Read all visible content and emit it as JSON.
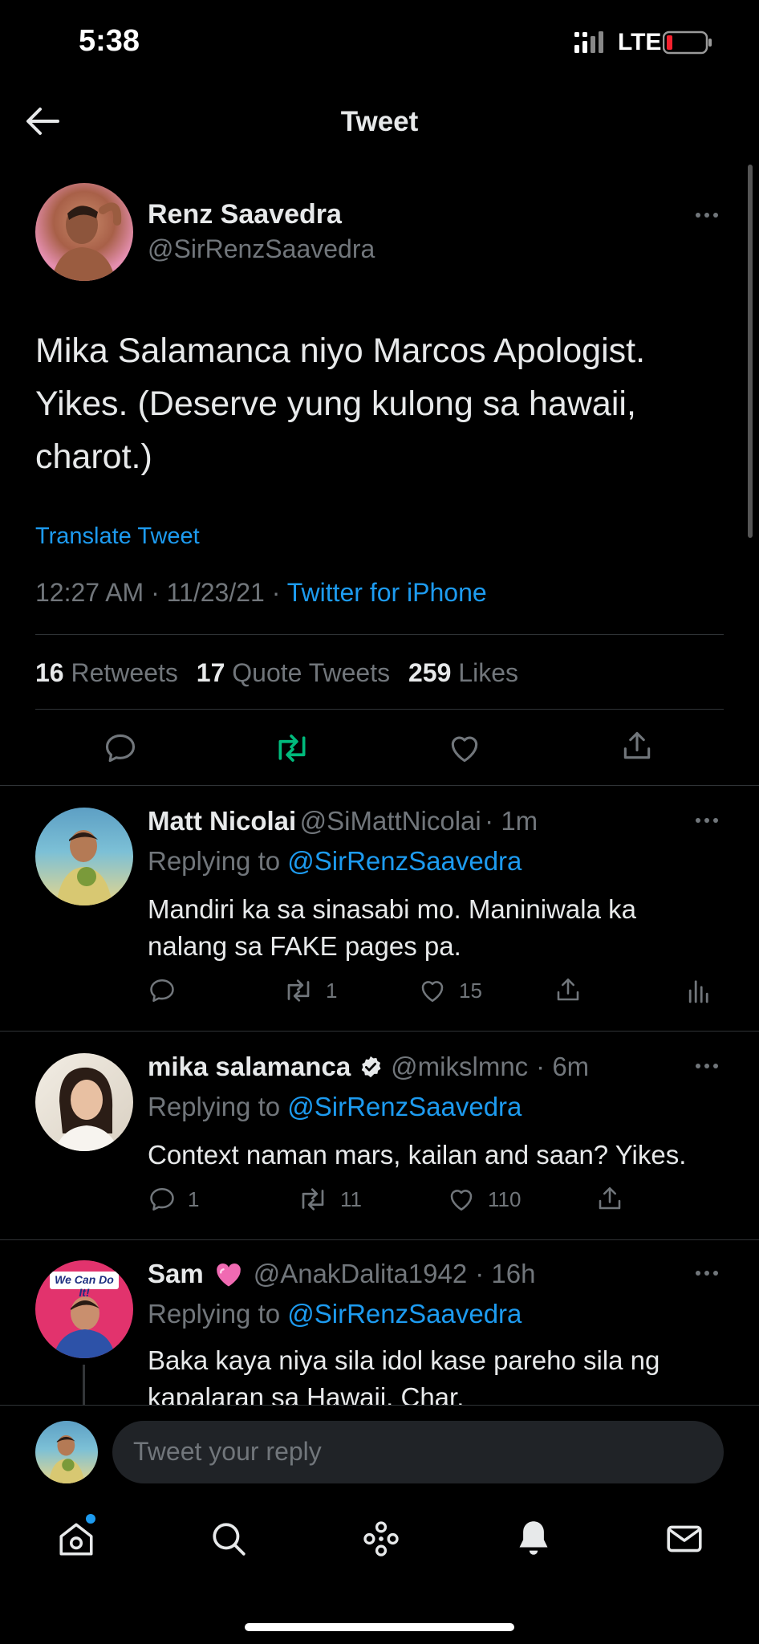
{
  "status_bar": {
    "time": "5:38",
    "network": "LTE"
  },
  "header": {
    "title": "Tweet"
  },
  "tweet": {
    "author_name": "Renz Saavedra",
    "author_handle": "@SirRenzSaavedra",
    "text": "Mika Salamanca niyo Marcos Apologist. Yikes. (Deserve yung kulong sa hawaii, charot.)",
    "translate_label": "Translate Tweet",
    "timestamp": "12:27 AM · 11/23/21 · ",
    "source": "Twitter for iPhone",
    "stats": {
      "retweets_count": "16",
      "retweets_label": "Retweets",
      "quotes_count": "17",
      "quotes_label": "Quote Tweets",
      "likes_count": "259",
      "likes_label": "Likes"
    }
  },
  "replies": [
    {
      "name": "Matt Nicolai",
      "handle": "@SiMattNicolai",
      "time": "· 1m",
      "replying_prefix": "Replying to ",
      "replying_to": "@SirRenzSaavedra",
      "text_line1": "Mandiri ka sa sinasabi mo. Maniniwala ka",
      "text_line2": "nalang sa FAKE pages pa.",
      "retweets": "1",
      "likes": "15"
    },
    {
      "name": "mika salamanca",
      "handle": "@mikslmnc",
      "time": "· 6m",
      "replying_prefix": "Replying to ",
      "replying_to": "@SirRenzSaavedra",
      "text_line1": "Context naman mars, kailan and saan? Yikes.",
      "replies": "1",
      "retweets": "11",
      "likes": "110"
    },
    {
      "name": "Sam",
      "handle": "@AnakDalita1942",
      "time": "· 16h",
      "replying_prefix": "Replying to ",
      "replying_to": "@SirRenzSaavedra",
      "text_line1": "Baka kaya niya sila idol kase pareho sila ng",
      "text_line2": "kapalaran sa Hawaii. Char.",
      "avatar_text": "We Can Do It!"
    }
  ],
  "composer": {
    "placeholder": "Tweet your reply"
  },
  "colors": {
    "accent": "#1d9bf0",
    "retweet_active": "#00ba7c",
    "battery_low": "#f4212e"
  }
}
